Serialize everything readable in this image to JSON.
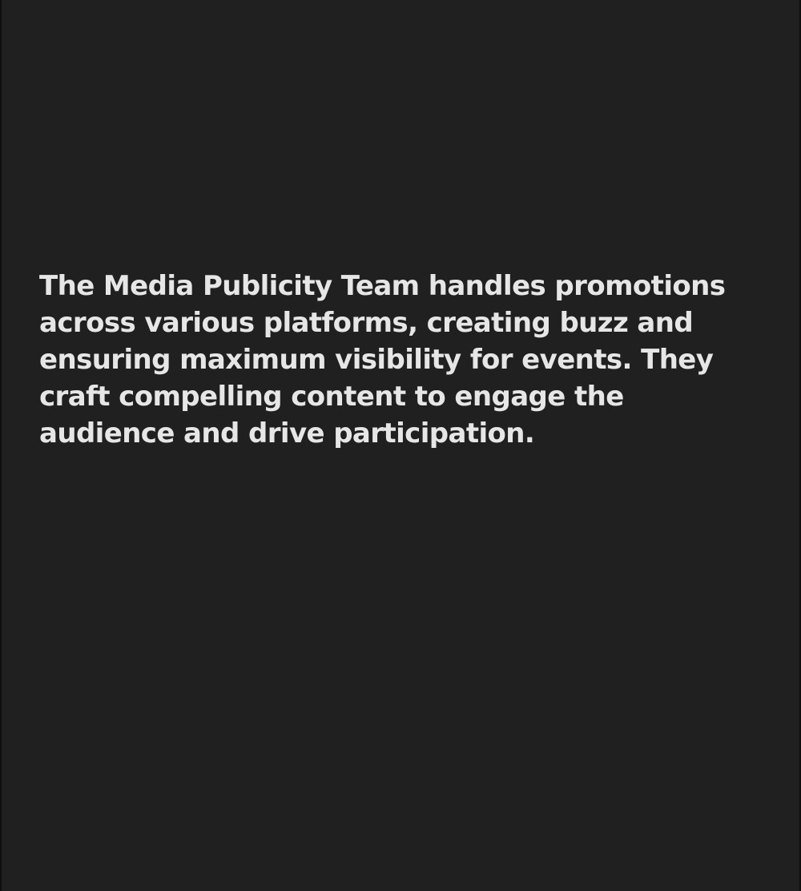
{
  "team_card": {
    "description": "The Media Publicity Team handles promotions\nacross various platforms, creating buzz and\nensuring maximum visibility for events. They\ncraft compelling content to engage the\naudience and drive participation."
  },
  "colors": {
    "background": "#202020",
    "text": "#e6e6e6"
  }
}
